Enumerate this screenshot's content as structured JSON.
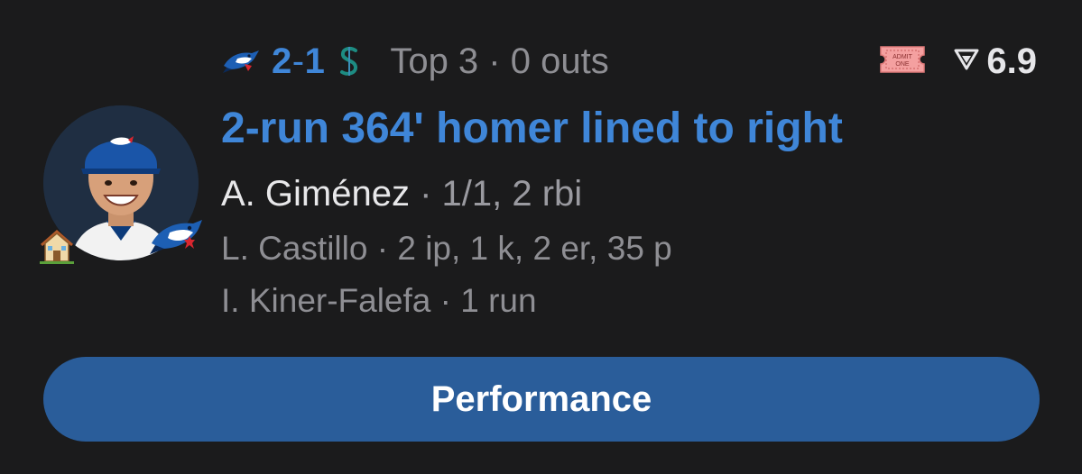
{
  "game": {
    "away_score": "2",
    "separator": "-",
    "home_score": "1",
    "inning_state": "Top 3 · 0 outs",
    "ticket_text_1": "ADMIT",
    "ticket_text_2": "ONE",
    "win_prob_value": "6.9",
    "away_team_icon": "blue-jays-logo-icon",
    "home_team_icon": "mariners-logo-icon"
  },
  "play": {
    "headline": "2-run 364' homer lined to right",
    "batter_name": "A. Giménez",
    "batter_stats": " · 1/1, 2 rbi",
    "pitcher_line": "L. Castillo · 2 ip, 1 k, 2 er, 35 p",
    "runner_line": "I. Kiner-Falefa · 1 run"
  },
  "actions": {
    "performance_label": "Performance"
  },
  "colors": {
    "accent": "#3f86d8",
    "button": "#2a5d9a",
    "background": "#1b1b1c"
  }
}
